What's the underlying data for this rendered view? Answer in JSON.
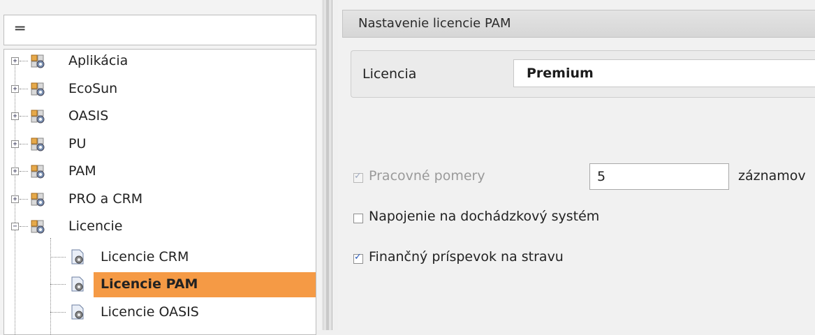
{
  "filter": {
    "icon": "filter-icon"
  },
  "tree": {
    "items": [
      {
        "label": "Aplikácia",
        "expanded": false,
        "icon": "settings-group-icon"
      },
      {
        "label": "EcoSun",
        "expanded": false,
        "icon": "settings-group-icon"
      },
      {
        "label": "OASIS",
        "expanded": false,
        "icon": "settings-group-icon"
      },
      {
        "label": "PU",
        "expanded": false,
        "icon": "settings-group-icon"
      },
      {
        "label": "PAM",
        "expanded": false,
        "icon": "settings-group-icon"
      },
      {
        "label": "PRO a CRM",
        "expanded": false,
        "icon": "settings-group-icon"
      },
      {
        "label": "Licencie",
        "expanded": true,
        "icon": "settings-group-icon"
      }
    ],
    "children": [
      {
        "label": "Licencie CRM",
        "selected": false,
        "icon": "settings-doc-icon"
      },
      {
        "label": "Licencie PAM",
        "selected": true,
        "icon": "settings-doc-icon"
      },
      {
        "label": "Licencie OASIS",
        "selected": false,
        "icon": "settings-doc-icon"
      }
    ],
    "selection_color": "#f59a45"
  },
  "panel": {
    "title": "Nastavenie licencie PAM",
    "license_label": "Licencia",
    "license_value": "Premium",
    "employment": {
      "label": "Pracovné pomery",
      "checked": true,
      "disabled": true,
      "records_value": "5",
      "records_unit": "záznamov"
    },
    "attendance": {
      "label": "Napojenie na dochádzkový systém",
      "checked": false
    },
    "meal": {
      "label": "Finančný príspevok na stravu",
      "checked": true
    }
  }
}
